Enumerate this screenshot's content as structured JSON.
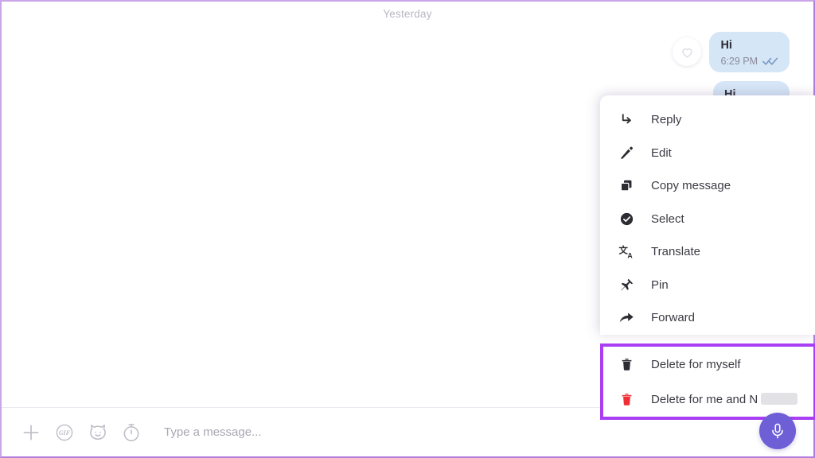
{
  "colors": {
    "highlight_purple": "#a93ff2",
    "page_border": "#b07fdc",
    "bubble_blue": "#d5e6f7",
    "mic_purple": "#6e5fd6",
    "delete_red": "#ef2e35"
  },
  "chat": {
    "day_divider": "Yesterday",
    "messages": [
      {
        "text": "Hi",
        "time": "6:29 PM",
        "status_icon": "double-check-icon"
      },
      {
        "text": "Hi",
        "time": "",
        "status_icon": ""
      }
    ],
    "reaction_button_icon": "heart-icon"
  },
  "context_menu": {
    "items": [
      {
        "label": "Reply",
        "icon": "reply-arrow-icon"
      },
      {
        "label": "Edit",
        "icon": "pencil-icon"
      },
      {
        "label": "Copy message",
        "icon": "copy-icon"
      },
      {
        "label": "Select",
        "icon": "check-circle-icon"
      },
      {
        "label": "Translate",
        "icon": "translate-icon"
      },
      {
        "label": "Pin",
        "icon": "pin-icon"
      },
      {
        "label": "Forward",
        "icon": "forward-arrow-icon"
      }
    ],
    "delete_group": {
      "items": [
        {
          "label": "Delete for myself",
          "icon": "trash-black-icon"
        },
        {
          "label": "Delete for me and N",
          "icon": "trash-red-icon",
          "redacted": true
        }
      ]
    }
  },
  "composer": {
    "placeholder": "Type a message...",
    "value": "",
    "tools": [
      {
        "name": "plus-icon",
        "label": "Attach"
      },
      {
        "name": "gif-icon",
        "label": "GIF"
      },
      {
        "name": "sticker-icon",
        "label": "Sticker"
      },
      {
        "name": "timer-icon",
        "label": "Timer"
      }
    ],
    "mic_icon": "microphone-icon"
  }
}
